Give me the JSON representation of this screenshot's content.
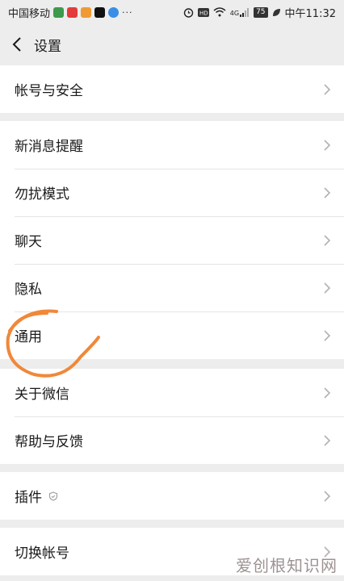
{
  "status": {
    "carrier": "中国移动",
    "more": "···",
    "signal_tag": "4G",
    "battery": "75",
    "time": "中午11:32",
    "icons": [
      "alarm-icon",
      "hd-icon",
      "wifi-icon",
      "signal-icon",
      "leaf-icon"
    ]
  },
  "nav": {
    "title": "设置",
    "back_icon": "chevron-left-icon"
  },
  "groups": [
    {
      "items": [
        {
          "label": "帐号与安全"
        }
      ]
    },
    {
      "items": [
        {
          "label": "新消息提醒"
        },
        {
          "label": "勿扰模式"
        },
        {
          "label": "聊天"
        },
        {
          "label": "隐私"
        },
        {
          "label": "通用"
        }
      ]
    },
    {
      "items": [
        {
          "label": "关于微信"
        },
        {
          "label": "帮助与反馈"
        }
      ]
    },
    {
      "items": [
        {
          "label": "插件",
          "badge_icon": "shield-icon"
        }
      ]
    },
    {
      "items": [
        {
          "label": "切换帐号"
        }
      ]
    }
  ],
  "annotation_color": "#f0883a",
  "watermark": "爱创根知识网"
}
